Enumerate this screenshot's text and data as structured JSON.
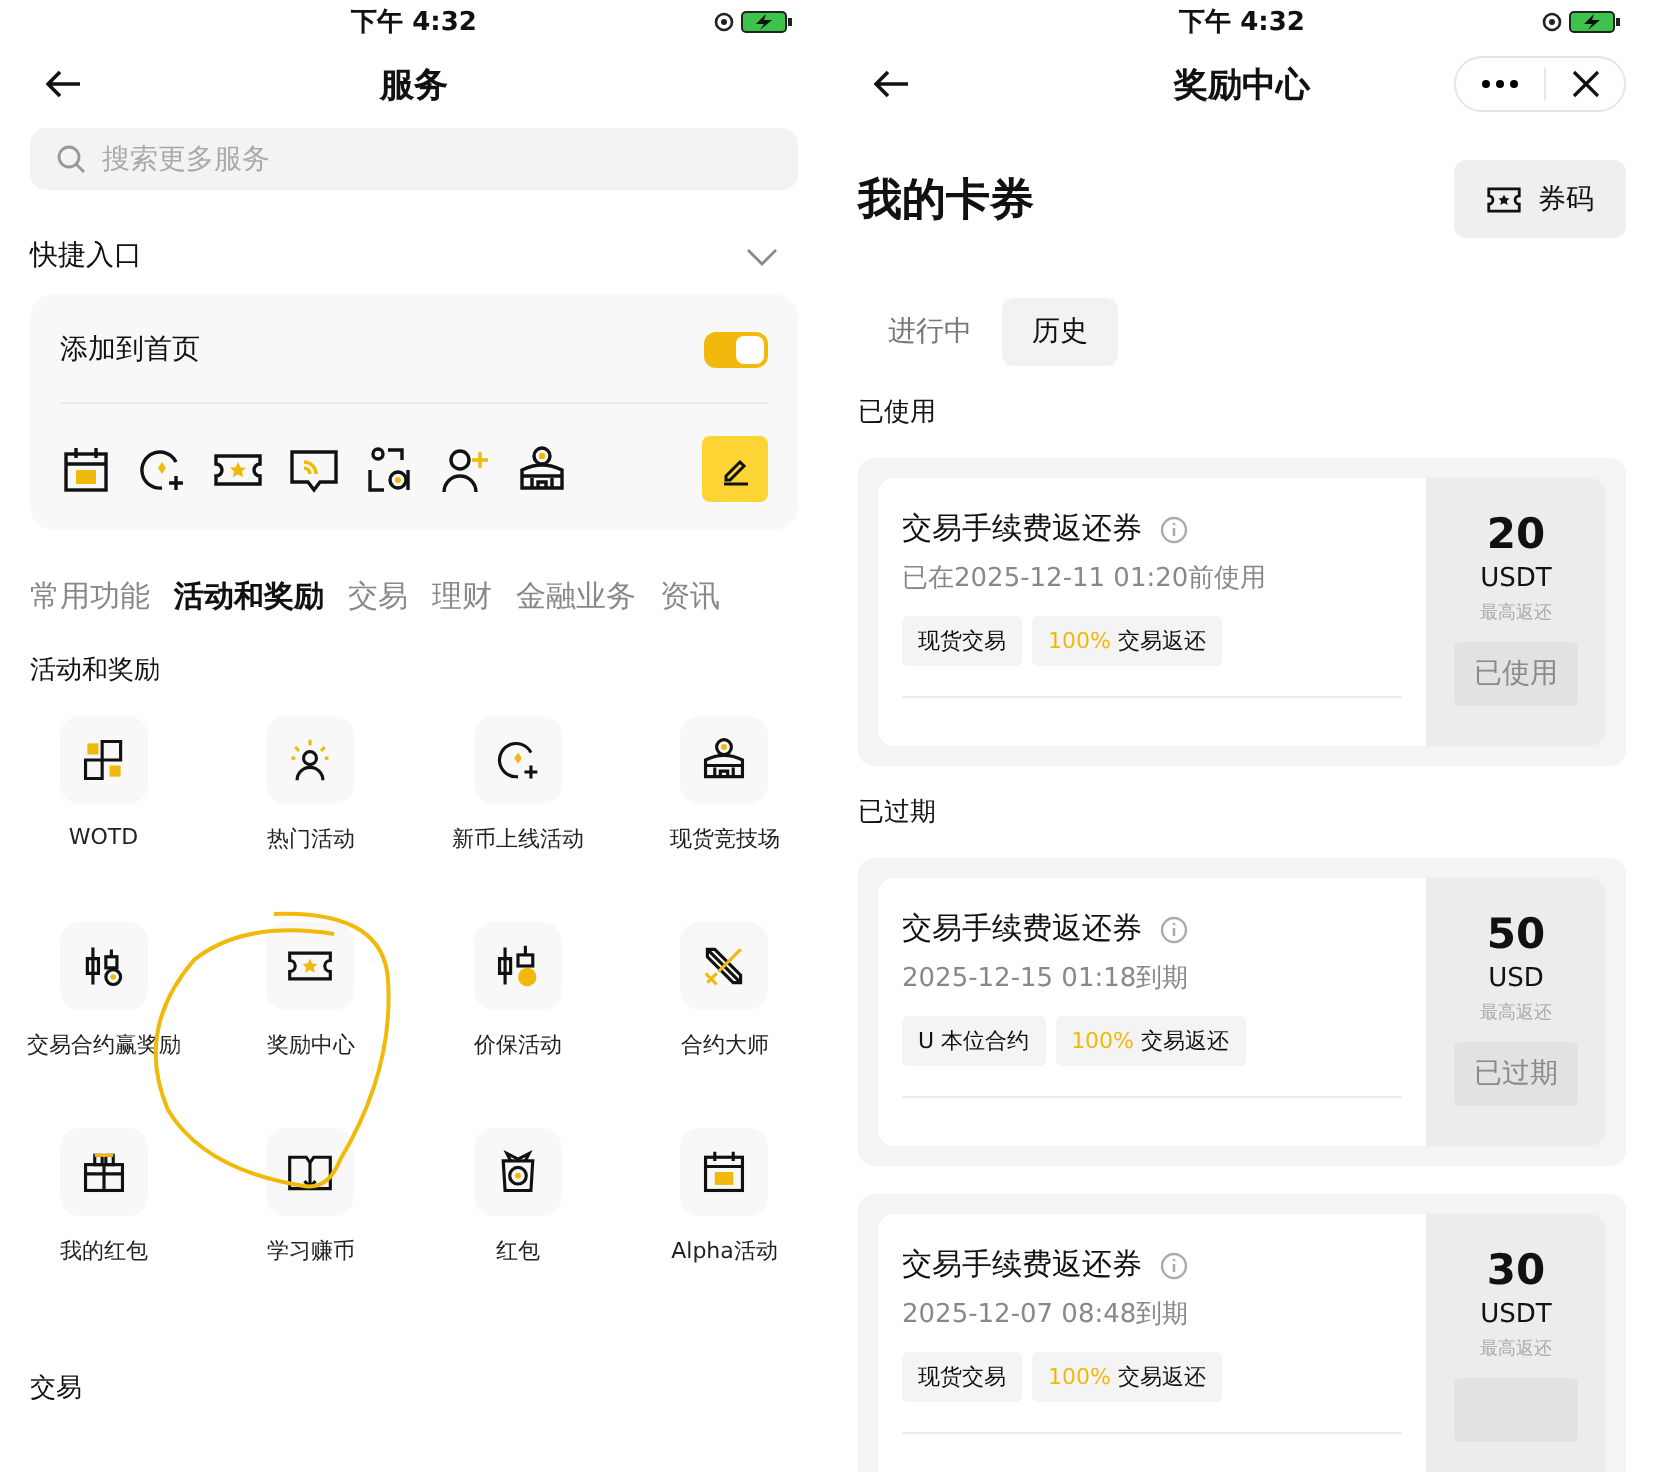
{
  "services_screen": {
    "status_time": "下午 4:32",
    "title": "服务",
    "search": {
      "placeholder": "搜索更多服务"
    },
    "quick_entry": {
      "title": "快捷入口",
      "add_label": "添加到首页",
      "toggle_on": true,
      "shortcuts": [
        {
          "kind": "calendar"
        },
        {
          "kind": "coin-plus"
        },
        {
          "kind": "ticket"
        },
        {
          "kind": "chat-signal"
        },
        {
          "kind": "scan-person"
        },
        {
          "kind": "person-plus"
        },
        {
          "kind": "arena"
        }
      ]
    },
    "category_tabs": [
      {
        "label": "常用功能",
        "selected": false
      },
      {
        "label": "活动和奖励",
        "selected": true
      },
      {
        "label": "交易",
        "selected": false
      },
      {
        "label": "理财",
        "selected": false
      },
      {
        "label": "金融业务",
        "selected": false
      },
      {
        "label": "资讯",
        "selected": false
      }
    ],
    "section_title": "活动和奖励",
    "items": [
      {
        "label": "WOTD",
        "kind": "blocks"
      },
      {
        "label": "热门活动",
        "kind": "person-sun"
      },
      {
        "label": "新币上线活动",
        "kind": "coin-plus"
      },
      {
        "label": "现货竞技场",
        "kind": "arena"
      },
      {
        "label": "交易合约赢奖励",
        "kind": "candles"
      },
      {
        "label": "奖励中心",
        "kind": "ticket"
      },
      {
        "label": "价保活动",
        "kind": "candles-coin"
      },
      {
        "label": "合约大师",
        "kind": "swords"
      },
      {
        "label": "我的红包",
        "kind": "gift"
      },
      {
        "label": "学习赚币",
        "kind": "book"
      },
      {
        "label": "红包",
        "kind": "gift-bag"
      },
      {
        "label": "Alpha活动",
        "kind": "calendar"
      }
    ],
    "next_section_title": "交易"
  },
  "rewards_screen": {
    "status_time": "下午 4:32",
    "title": "奖励中心",
    "heading": "我的卡券",
    "code_button": "券码",
    "tabs": [
      {
        "label": "进行中",
        "selected": false
      },
      {
        "label": "历史",
        "selected": true
      }
    ],
    "sections": [
      {
        "title": "已使用",
        "coupons": [
          {
            "title": "交易手续费返还券",
            "date": "已在2025-12-11 01:20前使用",
            "tags": [
              "现货交易"
            ],
            "rate": "100%",
            "rate_label": "交易返还",
            "amount": "20",
            "unit": "USDT",
            "note": "最高返还",
            "status": "已使用"
          }
        ]
      },
      {
        "title": "已过期",
        "coupons": [
          {
            "title": "交易手续费返还券",
            "date": "2025-12-15 01:18到期",
            "tags": [
              "U 本位合约"
            ],
            "rate": "100%",
            "rate_label": "交易返还",
            "amount": "50",
            "unit": "USD",
            "note": "最高返还",
            "status": "已过期"
          },
          {
            "title": "交易手续费返还券",
            "date": "2025-12-07 08:48到期",
            "tags": [
              "现货交易"
            ],
            "rate": "100%",
            "rate_label": "交易返还",
            "amount": "30",
            "unit": "USDT",
            "note": "最高返还"
          }
        ]
      }
    ]
  }
}
